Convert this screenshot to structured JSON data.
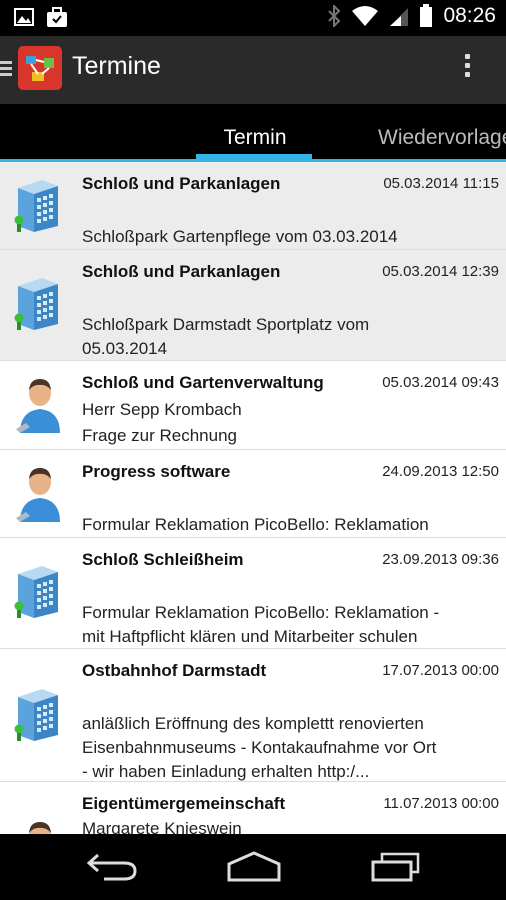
{
  "status_bar": {
    "time": "08:26",
    "icons": [
      "image-icon",
      "briefcase-icon",
      "bluetooth-icon",
      "wifi-icon",
      "signal-icon",
      "battery-icon"
    ]
  },
  "action_bar": {
    "title": "Termine",
    "icons": [
      "drawer-icon",
      "app-logo-icon",
      "overflow-menu-icon"
    ]
  },
  "tabs": [
    {
      "label": "Termin",
      "selected": true
    },
    {
      "label": "Wiedervorlage",
      "selected": false
    }
  ],
  "accent_color": "#33b5e5",
  "list": [
    {
      "icon": "building-icon",
      "title": "Schloß und Parkanlagen",
      "date": "05.03.2014 11:15",
      "lines": [
        "Schloßpark Gartenpflege vom 03.03.2014"
      ]
    },
    {
      "icon": "building-icon",
      "title": "Schloß und Parkanlagen",
      "date": "05.03.2014 12:39",
      "lines": [
        "Schloßpark Darmstadt Sportplatz vom",
        "05.03.2014"
      ]
    },
    {
      "icon": "person-icon",
      "title": "Schloß und Gartenverwaltung",
      "date": "05.03.2014 09:43",
      "lines": [
        "Herr Sepp Krombach",
        "Frage zur Rechnung"
      ]
    },
    {
      "icon": "person-icon",
      "title": "Progress software",
      "date": "24.09.2013 12:50",
      "lines": [
        "Formular Reklamation PicoBello: Reklamation"
      ]
    },
    {
      "icon": "building-icon",
      "title": "Schloß Schleißheim",
      "date": "23.09.2013 09:36",
      "lines": [
        "Formular Reklamation PicoBello: Reklamation -",
        "mit Haftpflicht klären und Mitarbeiter schulen"
      ]
    },
    {
      "icon": "building-icon",
      "title": "Ostbahnhof Darmstadt",
      "date": "17.07.2013 00:00",
      "lines": [
        "anläßlich Eröffnung des komplettt renovierten",
        "Eisenbahnmuseums  - Kontakaufnahme vor Ort",
        "- wir haben Einladung erhalten  http:/..."
      ]
    },
    {
      "icon": "person-icon",
      "title": "Eigentümergemeinschaft",
      "date": "11.07.2013 00:00",
      "lines": [
        "Margarete Knieswein"
      ]
    }
  ],
  "nav_bar": {
    "icons": [
      "back-icon",
      "home-icon",
      "recent-apps-icon"
    ]
  }
}
